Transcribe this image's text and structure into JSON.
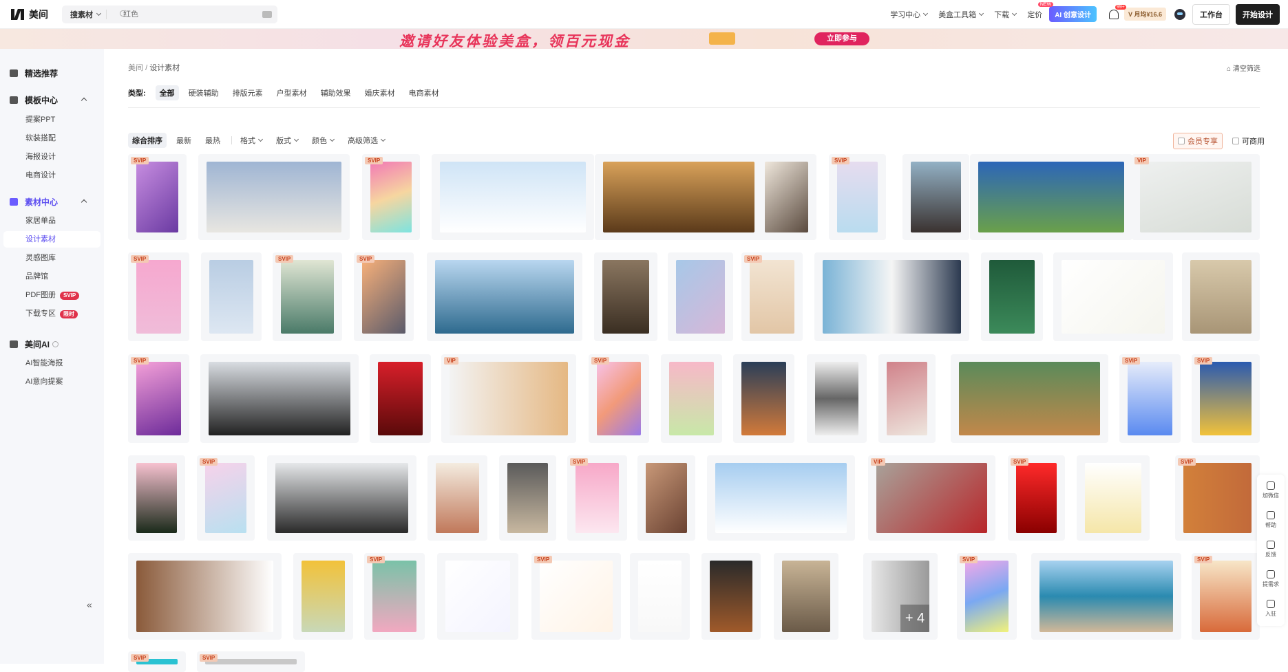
{
  "header": {
    "logo_text": "美间",
    "search_type": "搜素材",
    "search_placeholder": "红色",
    "nav": [
      "学习中心",
      "美盒工具箱",
      "下载",
      "定价"
    ],
    "new_tag": "NEW",
    "ai_button": "AI 创意设计",
    "notif_badge": "99+",
    "vip_label": "V 月均¥16.6",
    "workspace_button": "工作台",
    "start_button": "开始设计"
  },
  "banner": {
    "text": "邀请好友体验美盒，领百元现金",
    "button": "立即参与"
  },
  "sidebar": {
    "groups": [
      {
        "label": "精选推荐"
      },
      {
        "label": "模板中心",
        "items": [
          "提案PPT",
          "软装搭配",
          "海报设计",
          "电商设计"
        ]
      },
      {
        "label": "素材中心",
        "items": [
          "家居单品",
          "设计素材",
          "灵感图库",
          "品牌馆",
          "PDF图册",
          "下载专区"
        ]
      },
      {
        "label": "美间AI",
        "items": [
          "AI智能海报",
          "AI意向提案"
        ]
      }
    ],
    "pdf_tag": "SVIP",
    "download_tag": "限时",
    "collapse": "«"
  },
  "breadcrumb": {
    "root": "美间",
    "sep": "/",
    "current": "设计素材"
  },
  "clear_filter": "清空筛选",
  "types": {
    "label": "类型:",
    "options": [
      "全部",
      "硬装辅助",
      "排版元素",
      "户型素材",
      "辅助效果",
      "婚庆素材",
      "电商素材"
    ],
    "selected": "全部"
  },
  "sort": {
    "options": [
      "综合排序",
      "最新",
      "最热"
    ],
    "filters": [
      "格式",
      "版式",
      "颜色",
      "高级筛选"
    ],
    "selected": "综合排序"
  },
  "right_filters": {
    "vip_only": "会员专享",
    "commercial": "可商用"
  },
  "float_bar": [
    "加微信",
    "帮助",
    "反馈",
    "提需求",
    "入驻"
  ],
  "grid": {
    "plus_more": "+ 4",
    "tags": [
      "SVIP",
      "VIP"
    ]
  },
  "colors": {
    "accent": "#5b4cf0",
    "svip_tag": "#f4c9b4",
    "red_tag": "#e0324b"
  }
}
